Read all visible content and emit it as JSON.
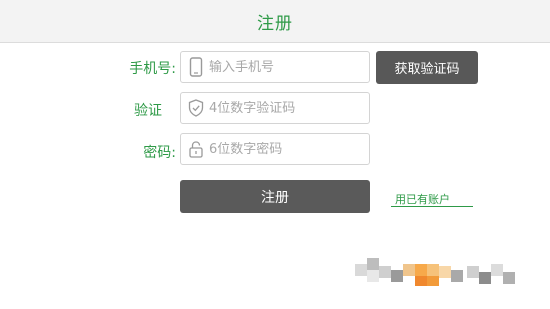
{
  "header": {
    "title": "注册"
  },
  "form": {
    "phone": {
      "label": "手机号:",
      "placeholder": "输入手机号",
      "icon": "phone-icon"
    },
    "code": {
      "label": "验证",
      "placeholder": "4位数字验证码",
      "icon": "shield-check-icon"
    },
    "password": {
      "label": "密码:",
      "placeholder": "6位数字密码",
      "icon": "lock-icon"
    },
    "get_code_label": "获取验证码",
    "register_label": "注册",
    "existing_account_label": "用已有账户"
  },
  "colors": {
    "accent": "#2e9a47",
    "button": "#5a5a5a"
  }
}
